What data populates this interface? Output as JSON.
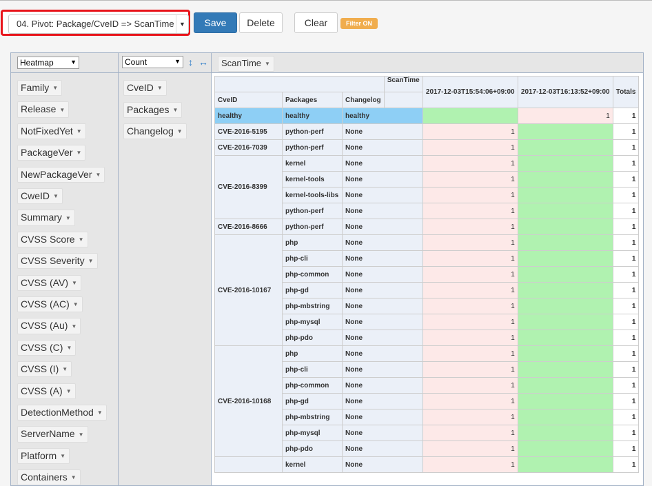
{
  "toolbar": {
    "preset": "04. Pivot: Package/CveID => ScanTime",
    "save": "Save",
    "delete": "Delete",
    "clear": "Clear",
    "filter_badge": "Filter ON",
    "colors": {
      "highlight": "#e8141b",
      "primary": "#337ab7",
      "badge": "#f0ad4e"
    }
  },
  "pivot": {
    "renderer": "Heatmap",
    "aggregator": "Count",
    "col_attrs": [
      "ScanTime"
    ],
    "row_attrs": [
      "CveID",
      "Packages",
      "Changelog"
    ],
    "unused_attrs": [
      "Family",
      "Release",
      "NotFixedYet",
      "PackageVer",
      "NewPackageVer",
      "CweID",
      "Summary",
      "CVSS Score",
      "CVSS Severity",
      "CVSS (AV)",
      "CVSS (AC)",
      "CVSS (Au)",
      "CVSS (C)",
      "CVSS (I)",
      "CVSS (A)",
      "DetectionMethod",
      "ServerName",
      "Platform",
      "Containers"
    ],
    "table": {
      "col_attr_label": "ScanTime",
      "row_headers": [
        "CveID",
        "Packages",
        "Changelog"
      ],
      "col_keys": [
        "2017-12-03T15:54:06+09:00",
        "2017-12-03T16:13:52+09:00"
      ],
      "totals_label": "Totals",
      "groups": [
        {
          "cve": "healthy",
          "rows": [
            {
              "pkg": "healthy",
              "chg": "healthy",
              "v1": "",
              "v2": "1",
              "t": "1"
            }
          ]
        },
        {
          "cve": "CVE-2016-5195",
          "rows": [
            {
              "pkg": "python-perf",
              "chg": "None",
              "v1": "1",
              "v2": "",
              "t": "1"
            }
          ]
        },
        {
          "cve": "CVE-2016-7039",
          "rows": [
            {
              "pkg": "python-perf",
              "chg": "None",
              "v1": "1",
              "v2": "",
              "t": "1"
            }
          ]
        },
        {
          "cve": "CVE-2016-8399",
          "rows": [
            {
              "pkg": "kernel",
              "chg": "None",
              "v1": "1",
              "v2": "",
              "t": "1"
            },
            {
              "pkg": "kernel-tools",
              "chg": "None",
              "v1": "1",
              "v2": "",
              "t": "1"
            },
            {
              "pkg": "kernel-tools-libs",
              "chg": "None",
              "v1": "1",
              "v2": "",
              "t": "1"
            },
            {
              "pkg": "python-perf",
              "chg": "None",
              "v1": "1",
              "v2": "",
              "t": "1"
            }
          ]
        },
        {
          "cve": "CVE-2016-8666",
          "rows": [
            {
              "pkg": "python-perf",
              "chg": "None",
              "v1": "1",
              "v2": "",
              "t": "1"
            }
          ]
        },
        {
          "cve": "CVE-2016-10167",
          "rows": [
            {
              "pkg": "php",
              "chg": "None",
              "v1": "1",
              "v2": "",
              "t": "1"
            },
            {
              "pkg": "php-cli",
              "chg": "None",
              "v1": "1",
              "v2": "",
              "t": "1"
            },
            {
              "pkg": "php-common",
              "chg": "None",
              "v1": "1",
              "v2": "",
              "t": "1"
            },
            {
              "pkg": "php-gd",
              "chg": "None",
              "v1": "1",
              "v2": "",
              "t": "1"
            },
            {
              "pkg": "php-mbstring",
              "chg": "None",
              "v1": "1",
              "v2": "",
              "t": "1"
            },
            {
              "pkg": "php-mysql",
              "chg": "None",
              "v1": "1",
              "v2": "",
              "t": "1"
            },
            {
              "pkg": "php-pdo",
              "chg": "None",
              "v1": "1",
              "v2": "",
              "t": "1"
            }
          ]
        },
        {
          "cve": "CVE-2016-10168",
          "rows": [
            {
              "pkg": "php",
              "chg": "None",
              "v1": "1",
              "v2": "",
              "t": "1"
            },
            {
              "pkg": "php-cli",
              "chg": "None",
              "v1": "1",
              "v2": "",
              "t": "1"
            },
            {
              "pkg": "php-common",
              "chg": "None",
              "v1": "1",
              "v2": "",
              "t": "1"
            },
            {
              "pkg": "php-gd",
              "chg": "None",
              "v1": "1",
              "v2": "",
              "t": "1"
            },
            {
              "pkg": "php-mbstring",
              "chg": "None",
              "v1": "1",
              "v2": "",
              "t": "1"
            },
            {
              "pkg": "php-mysql",
              "chg": "None",
              "v1": "1",
              "v2": "",
              "t": "1"
            },
            {
              "pkg": "php-pdo",
              "chg": "None",
              "v1": "1",
              "v2": "",
              "t": "1"
            }
          ]
        },
        {
          "cve": "",
          "rows": [
            {
              "pkg": "kernel",
              "chg": "None",
              "v1": "1",
              "v2": "",
              "t": "1"
            }
          ]
        }
      ]
    }
  }
}
